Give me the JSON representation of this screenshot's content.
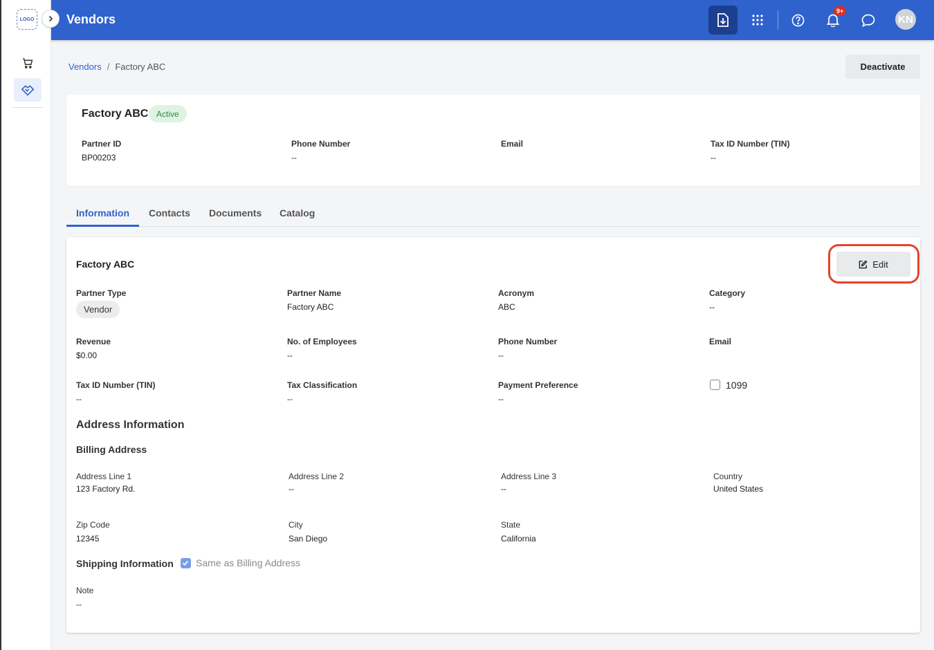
{
  "app": {
    "logo_text": "LOGO",
    "page_title": "Vendors",
    "notification_count": "9+",
    "user_initials": "KN"
  },
  "breadcrumb": {
    "parent": "Vendors",
    "separator": "/",
    "current": "Factory ABC"
  },
  "actions": {
    "deactivate_label": "Deactivate",
    "edit_label": "Edit"
  },
  "summary": {
    "name": "Factory ABC",
    "status": "Active",
    "fields": [
      {
        "label": "Partner ID",
        "value": "BP00203"
      },
      {
        "label": "Phone Number",
        "value": "--"
      },
      {
        "label": "Email",
        "value": ""
      },
      {
        "label": "Tax ID Number (TIN)",
        "value": "--"
      }
    ]
  },
  "tabs": [
    {
      "label": "Information",
      "active": true
    },
    {
      "label": "Contacts",
      "active": false
    },
    {
      "label": "Documents",
      "active": false
    },
    {
      "label": "Catalog",
      "active": false
    }
  ],
  "info": {
    "title": "Factory ABC",
    "partner_type": {
      "label": "Partner Type",
      "value": "Vendor"
    },
    "partner_name": {
      "label": "Partner Name",
      "value": "Factory ABC"
    },
    "acronym": {
      "label": "Acronym",
      "value": "ABC"
    },
    "category": {
      "label": "Category",
      "value": "--"
    },
    "revenue": {
      "label": "Revenue",
      "value": "$0.00"
    },
    "employees": {
      "label": "No. of Employees",
      "value": "--"
    },
    "phone": {
      "label": "Phone Number",
      "value": "--"
    },
    "email": {
      "label": "Email",
      "value": ""
    },
    "tin": {
      "label": "Tax ID Number (TIN)",
      "value": "--"
    },
    "tax_class": {
      "label": "Tax Classification",
      "value": "--"
    },
    "payment_pref": {
      "label": "Payment Preference",
      "value": "--"
    },
    "form_1099": {
      "label": "1099",
      "checked": false
    }
  },
  "address": {
    "section_title": "Address Information",
    "billing_title": "Billing Address",
    "line1": {
      "label": "Address Line 1",
      "value": "123 Factory Rd."
    },
    "line2": {
      "label": "Address Line 2",
      "value": "--"
    },
    "line3": {
      "label": "Address Line 3",
      "value": "--"
    },
    "country": {
      "label": "Country",
      "value": "United States"
    },
    "zip": {
      "label": "Zip Code",
      "value": "12345"
    },
    "city": {
      "label": "City",
      "value": "San Diego"
    },
    "state": {
      "label": "State",
      "value": "California"
    },
    "shipping_title": "Shipping Information",
    "same_as_billing": {
      "label": "Same as Billing Address",
      "checked": true
    },
    "note": {
      "label": "Note",
      "value": "--"
    }
  },
  "colors": {
    "primary": "#2f62cc",
    "primary_dark": "#1d3f8f",
    "highlight_ring": "#e3442b",
    "active_green": "#2f8a3d"
  },
  "icons": [
    "chevron-right-icon",
    "cart-icon",
    "handshake-icon",
    "download-icon",
    "apps-grid-icon",
    "help-icon",
    "bell-icon",
    "chat-icon",
    "edit-pencil-icon"
  ]
}
